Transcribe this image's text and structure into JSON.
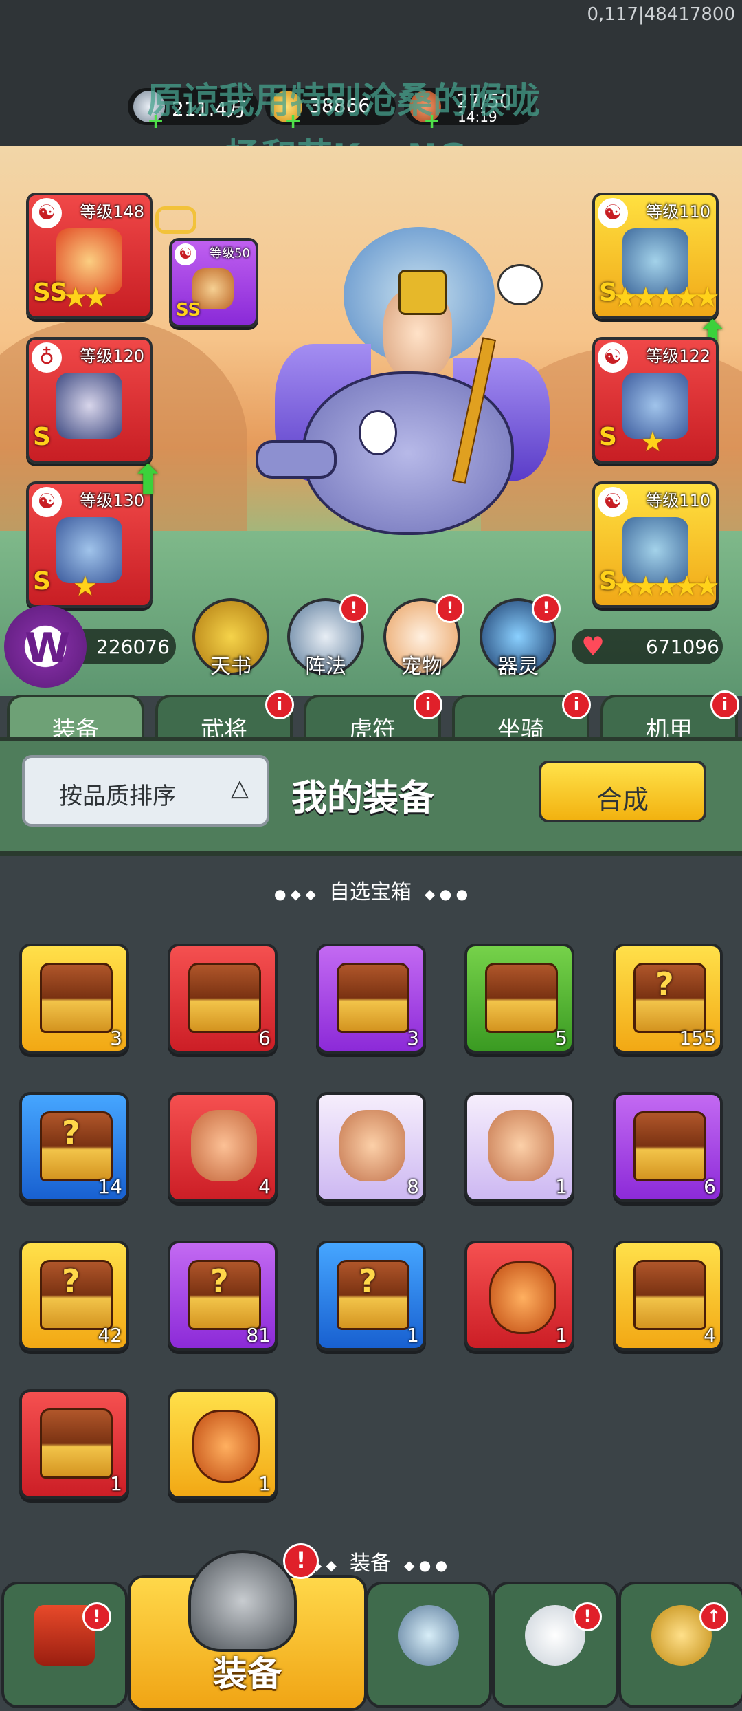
{
  "status": {
    "coords_text": "0,117|48417800"
  },
  "resources": {
    "silver": "211.4万",
    "gold": "38866",
    "stamina": "27/50",
    "stamina_timer": "14:19"
  },
  "overlay_text": {
    "line1": "原谅我用特别沧桑的喉咙",
    "line2": "杨和苏KeyNG:"
  },
  "equipment_slots": {
    "left1": {
      "level": "等级148",
      "grade": "SS"
    },
    "left_small": {
      "level": "等级50",
      "grade": "SS"
    },
    "left2": {
      "level": "等级120",
      "grade": "S"
    },
    "left3": {
      "level": "等级130",
      "grade": "S"
    },
    "right1": {
      "level": "等级110",
      "grade": "S"
    },
    "right2": {
      "level": "等级122",
      "grade": "S"
    },
    "right3": {
      "level": "等级110",
      "grade": "S"
    }
  },
  "power": {
    "left_value": "226076",
    "right_value": "671096"
  },
  "feature_buttons": [
    "天书",
    "阵法",
    "宠物",
    "器灵"
  ],
  "tabs": [
    "装备",
    "武将",
    "虎符",
    "坐骑",
    "机甲"
  ],
  "toolbar": {
    "sort_label": "按品质排序",
    "title": "我的装备",
    "combine_label": "合成"
  },
  "section_chest": "自选宝箱",
  "section_equip": "装备",
  "badge_mark": "!",
  "items": [
    {
      "color": "yel",
      "kind": "chest",
      "count": "3"
    },
    {
      "color": "red",
      "kind": "chest",
      "count": "6"
    },
    {
      "color": "pur",
      "kind": "chest",
      "count": "3"
    },
    {
      "color": "grn",
      "kind": "chest",
      "count": "5"
    },
    {
      "color": "yel",
      "kind": "mystery",
      "count": "155"
    },
    {
      "color": "blu",
      "kind": "mystery",
      "count": "14"
    },
    {
      "color": "red",
      "kind": "hero",
      "count": "4"
    },
    {
      "color": "lav",
      "kind": "hero",
      "count": "8"
    },
    {
      "color": "lav",
      "kind": "hero",
      "count": "1"
    },
    {
      "color": "pur",
      "kind": "chest",
      "count": "6"
    },
    {
      "color": "yel",
      "kind": "mystery",
      "count": "42"
    },
    {
      "color": "pur",
      "kind": "mystery",
      "count": "81"
    },
    {
      "color": "blu",
      "kind": "mystery",
      "count": "1"
    },
    {
      "color": "red",
      "kind": "bag",
      "count": "1"
    },
    {
      "color": "yel",
      "kind": "chest",
      "count": "4"
    },
    {
      "color": "red",
      "kind": "chest",
      "count": "1"
    },
    {
      "color": "yel",
      "kind": "bag",
      "count": "1"
    }
  ],
  "bottom_nav": {
    "active_label": "装备"
  }
}
